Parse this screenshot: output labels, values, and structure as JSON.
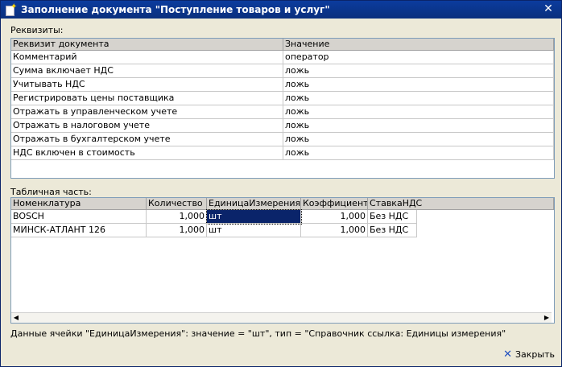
{
  "window": {
    "title": "Заполнение документа \"Поступление товаров и услуг\""
  },
  "requisites": {
    "label": "Реквизиты:",
    "columns": [
      "Реквизит документа",
      "Значение"
    ],
    "rows": [
      [
        "Комментарий",
        "оператор"
      ],
      [
        "Сумма включает НДС",
        "ложь"
      ],
      [
        "Учитывать НДС",
        "ложь"
      ],
      [
        "Регистрировать цены поставщика",
        "ложь"
      ],
      [
        "Отражать в управленческом учете",
        "ложь"
      ],
      [
        "Отражать в налоговом учете",
        "ложь"
      ],
      [
        "Отражать в бухгалтерском учете",
        "ложь"
      ],
      [
        "НДС включен в стоимость",
        "ложь"
      ]
    ]
  },
  "tabular": {
    "label": "Табличная часть:",
    "columns": [
      "Номенклатура",
      "Количество",
      "ЕдиницаИзмерения",
      "Коэффициент",
      "СтавкаНДС"
    ],
    "rows": [
      [
        "BOSCH",
        "1,000",
        "шт",
        "1,000",
        "Без НДС"
      ],
      [
        "МИНСК-АТЛАНТ 126",
        "1,000",
        "шт",
        "1,000",
        "Без НДС"
      ]
    ]
  },
  "status": "Данные ячейки \"ЕдиницаИзмерения\": значение = \"шт\", тип = \"Справочник ссылка: Единицы измерения\"",
  "buttons": {
    "close_label": "Закрыть"
  }
}
